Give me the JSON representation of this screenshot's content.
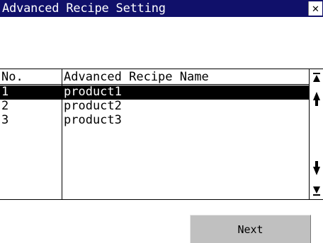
{
  "window": {
    "title": "Advanced Recipe Setting",
    "close_label": "✕"
  },
  "table": {
    "columns": [
      "No.",
      "Advanced Recipe Name"
    ],
    "rows": [
      {
        "no": "1",
        "name": "product1",
        "selected": true
      },
      {
        "no": "2",
        "name": "product2",
        "selected": false
      },
      {
        "no": "3",
        "name": "product3",
        "selected": false
      }
    ]
  },
  "scrollbar": {
    "icons": [
      "scroll-top-icon",
      "scroll-up-icon",
      "scroll-down-icon",
      "scroll-bottom-icon"
    ]
  },
  "footer": {
    "next_label": "Next"
  },
  "colors": {
    "titlebar": "#10106a",
    "selection": "#000000",
    "button": "#c0c0c0"
  }
}
